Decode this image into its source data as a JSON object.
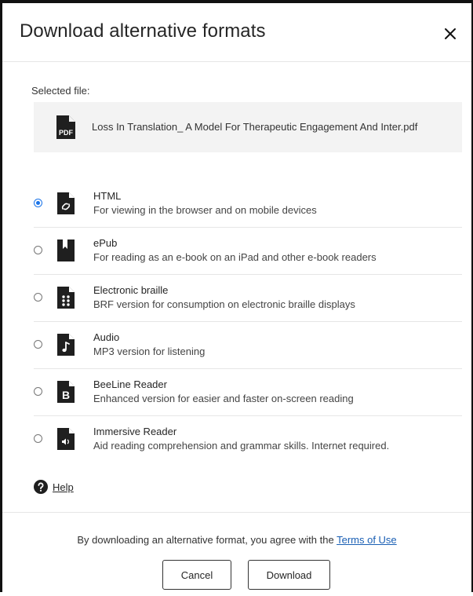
{
  "dialog": {
    "title": "Download alternative formats",
    "close_icon": "close-icon"
  },
  "selected_file": {
    "label": "Selected file:",
    "icon": "pdf-icon",
    "icon_text": "PDF",
    "name": "Loss In Translation_ A Model For Therapeutic Engagement And Inter.pdf"
  },
  "options": [
    {
      "name": "HTML",
      "desc": "For viewing in the browser and on mobile devices",
      "icon": "html-link-icon",
      "selected": true
    },
    {
      "name": "ePub",
      "desc": "For reading as an e-book on an iPad and other e-book readers",
      "icon": "bookmark-icon",
      "selected": false
    },
    {
      "name": "Electronic braille",
      "desc": "BRF version for consumption on electronic braille displays",
      "icon": "braille-icon",
      "selected": false
    },
    {
      "name": "Audio",
      "desc": "MP3 version for listening",
      "icon": "music-note-icon",
      "selected": false
    },
    {
      "name": "BeeLine Reader",
      "desc": "Enhanced version for easier and faster on-screen reading",
      "icon": "beeline-b-icon",
      "icon_text": "B",
      "selected": false
    },
    {
      "name": "Immersive Reader",
      "desc": "Aid reading comprehension and grammar skills. Internet required.",
      "icon": "speaker-icon",
      "selected": false
    }
  ],
  "help": {
    "icon": "question-circle-icon",
    "label": "Help"
  },
  "footer": {
    "agree_prefix": "By downloading an alternative format, you agree with the",
    "terms_label": "Terms of Use",
    "cancel_label": "Cancel",
    "download_label": "Download"
  },
  "colors": {
    "accent": "#1a73e8",
    "link": "#1a5fb4",
    "icon": "#1f1f1f",
    "file_box_bg": "#f3f3f3"
  }
}
